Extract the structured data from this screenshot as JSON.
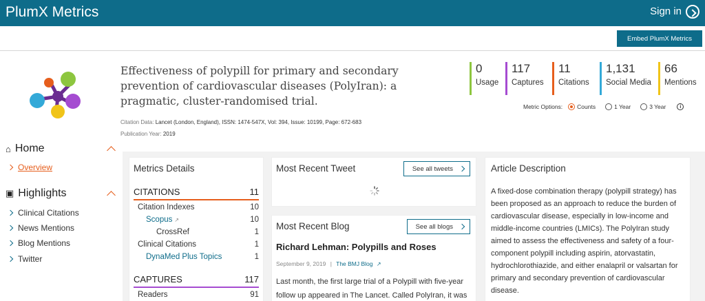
{
  "header": {
    "brand": "PlumX Metrics",
    "sign_in": "Sign in"
  },
  "embed_button": "Embed PlumX Metrics",
  "article": {
    "title": "Effectiveness of polypill for primary and secondary prevention of cardiovascular diseases (PolyIran): a pragmatic, cluster-randomised trial.",
    "citation_label": "Citation Data:",
    "citation_value": "Lancet (London, England), ISSN: 1474-547X, Vol: 394, Issue: 10199, Page: 672-683",
    "year_label": "Publication Year:",
    "year_value": "2019"
  },
  "metrics": [
    {
      "value": "0",
      "label": "Usage",
      "color": "#8dc63f"
    },
    {
      "value": "117",
      "label": "Captures",
      "color": "#a54bd1"
    },
    {
      "value": "11",
      "label": "Citations",
      "color": "#e65e1c"
    },
    {
      "value": "1,131",
      "label": "Social Media",
      "color": "#33a9d8"
    },
    {
      "value": "66",
      "label": "Mentions",
      "color": "#f0c419"
    }
  ],
  "metric_options": {
    "label": "Metric Options:",
    "options": [
      "Counts",
      "1 Year",
      "3 Year"
    ],
    "selected": "Counts"
  },
  "sidebar": {
    "home": "Home",
    "overview": "Overview",
    "highlights": "Highlights",
    "items": [
      "Clinical Citations",
      "News Mentions",
      "Blog Mentions",
      "Twitter"
    ]
  },
  "metrics_details": {
    "title": "Metrics Details",
    "citations": {
      "label": "CITATIONS",
      "value": "11",
      "rows": [
        {
          "label": "Citation Indexes",
          "value": "10"
        },
        {
          "label": "Scopus",
          "value": "10"
        },
        {
          "label": "CrossRef",
          "value": "1"
        },
        {
          "label": "Clinical Citations",
          "value": "1"
        },
        {
          "label": "DynaMed Plus Topics",
          "value": "1"
        }
      ]
    },
    "captures": {
      "label": "CAPTURES",
      "value": "117",
      "rows": [
        {
          "label": "Readers",
          "value": "91"
        }
      ]
    }
  },
  "tweet": {
    "title": "Most Recent Tweet",
    "button": "See all tweets"
  },
  "blog": {
    "title": "Most Recent Blog",
    "button": "See all blogs",
    "post_title": "Richard Lehman: Polypills and Roses",
    "date": "September 9, 2019",
    "separator": "|",
    "source": "The BMJ Blog",
    "excerpt": "Last month, the first large trial of a Polypill with five-year follow up appeared in The Lancet. Called PolyIran, it was"
  },
  "description": {
    "title": "Article Description",
    "text": "A fixed-dose combination therapy (polypill strategy) has been proposed as an approach to reduce the burden of cardiovascular disease, especially in low-income and middle-income countries (LMICs). The PolyIran study aimed to assess the effectiveness and safety of a four-component polypill including aspirin, atorvastatin, hydrochlorothiazide, and either enalapril or valsartan for primary and secondary prevention of cardiovascular disease."
  },
  "colors": {
    "brand": "#0e6c8a",
    "accent": "#e65e1c"
  }
}
